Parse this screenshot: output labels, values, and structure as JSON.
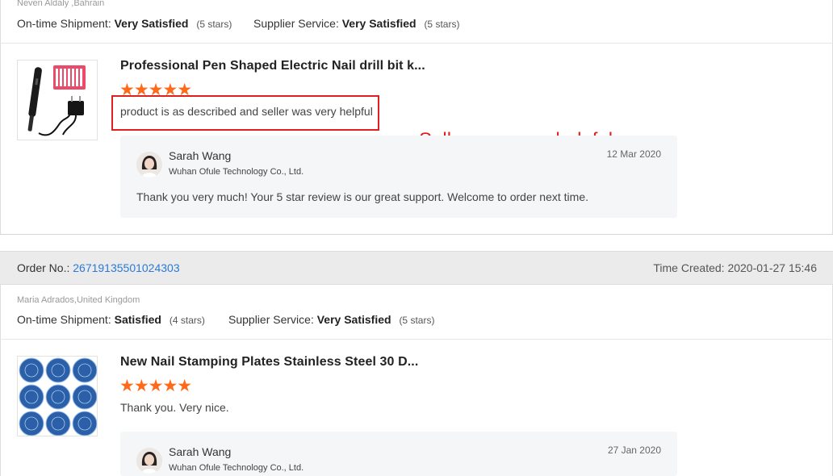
{
  "review1": {
    "buyer": "Neven Aldaly ,Bahrain",
    "shipment_label": "On-time Shipment:",
    "shipment_value": "Very Satisfied",
    "shipment_stars": "(5 stars)",
    "service_label": "Supplier Service:",
    "service_value": "Very Satisfied",
    "service_stars": "(5 stars)",
    "product_title": "Professional Pen Shaped Electric Nail drill bit k...",
    "stars": "★★★★★",
    "rating": 5,
    "review_text": "product is as described and seller was very helpful",
    "reply": {
      "seller_name": "Sarah Wang",
      "company": "Wuhan Ofule Technology Co., Ltd.",
      "date": "12 Mar 2020",
      "text": "Thank you very much! Your 5 star review is our great support. Welcome to order next time."
    }
  },
  "annotation": "Seller was very helpful",
  "order2": {
    "order_label": "Order No.:",
    "order_number": "26719135501024303",
    "time_label": "Time Created:",
    "time_value": "2020-01-27 15:46",
    "buyer": "Maria Adrados,United Kingdom",
    "shipment_label": "On-time Shipment:",
    "shipment_value": "Satisfied",
    "shipment_stars": "(4 stars)",
    "service_label": "Supplier Service:",
    "service_value": "Very Satisfied",
    "service_stars": "(5 stars)",
    "product_title": "New Nail Stamping Plates Stainless Steel 30 D...",
    "stars": "★★★★★",
    "rating": 5,
    "review_text": "Thank you. Very nice.",
    "reply": {
      "seller_name": "Sarah Wang",
      "company": "Wuhan Ofule Technology Co., Ltd.",
      "date": "27 Jan 2020"
    }
  },
  "colors": {
    "star": "#ff6a1a",
    "annotation": "#e02020",
    "link": "#2a7ad6",
    "order_bar": "#ebebeb"
  }
}
